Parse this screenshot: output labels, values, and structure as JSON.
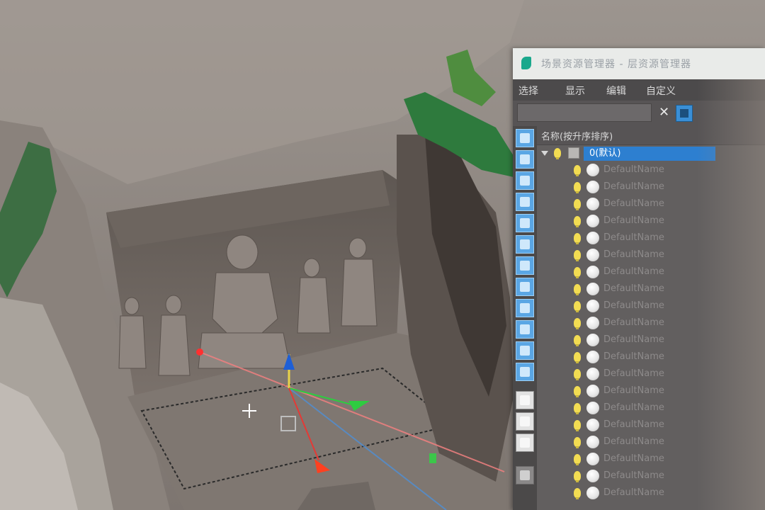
{
  "window": {
    "title": "场景资源管理器 - 层资源管理器"
  },
  "menu": {
    "items": [
      "选择",
      "显示",
      "编辑",
      "自定义"
    ]
  },
  "search": {
    "value": "",
    "placeholder": ""
  },
  "tree": {
    "column_header": "名称(按升序排序)",
    "root_layer": "0(默认)",
    "object_name": "DefaultName",
    "object_count": 20
  },
  "colors": {
    "panel_bg": "#625f5f",
    "selection_blue": "#2d7fd0",
    "bulb_yellow": "#f2dc52",
    "gizmo_x": "#e53935",
    "gizmo_y": "#2ecc40",
    "gizmo_z": "#1e5fd6"
  },
  "icons": {
    "clear": "close-icon",
    "filter": "filter-toggle-icon",
    "visibility": "lightbulb-icon",
    "object": "sphere-icon",
    "layer": "layer-icon"
  }
}
